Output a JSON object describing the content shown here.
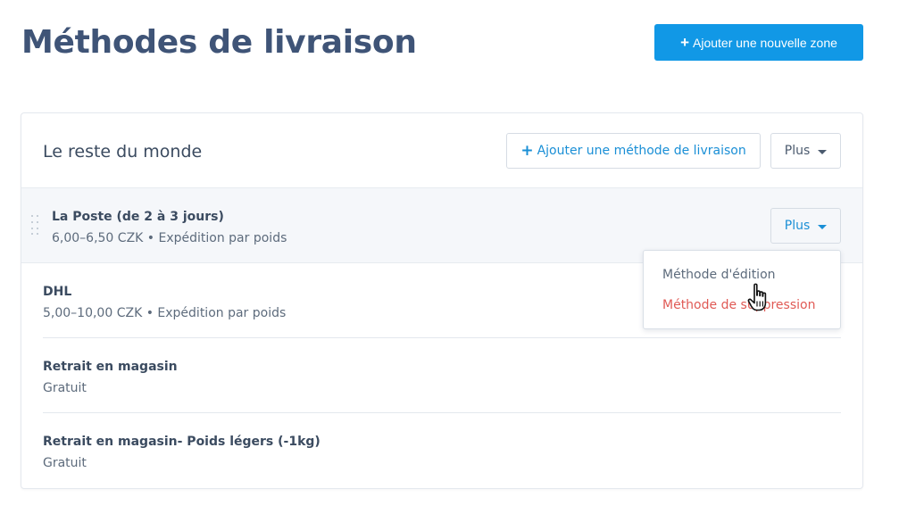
{
  "page": {
    "title": "Méthodes de livraison",
    "add_zone_button": "Ajouter une nouvelle zone",
    "plus_glyph": "+"
  },
  "zone": {
    "title": "Le reste du monde",
    "add_method_button": "Ajouter une méthode de livraison",
    "more_button": "Plus"
  },
  "methods": [
    {
      "name": "La Poste (de 2 à 3 jours)",
      "description": "6,00–6,50 CZK • Expédition par poids",
      "more_button": "Plus"
    },
    {
      "name": "DHL",
      "description": "5,00–10,00 CZK • Expédition par poids"
    },
    {
      "name": "Retrait en magasin",
      "description": "Gratuit"
    },
    {
      "name": "Retrait en magasin- Poids légers (-1kg)",
      "description": "Gratuit"
    }
  ],
  "dropdown": {
    "items": [
      {
        "label": "Méthode d'édition"
      },
      {
        "label": "Méthode de suppression"
      }
    ]
  },
  "colors": {
    "primary": "#1198e6",
    "title": "#3f5477",
    "danger": "#e05a55",
    "row_highlight": "#f5f7fa"
  },
  "icons": {
    "cursor": "hand-pointer-icon",
    "drag": "drag-handle-icon",
    "caret": "caret-down-icon"
  }
}
